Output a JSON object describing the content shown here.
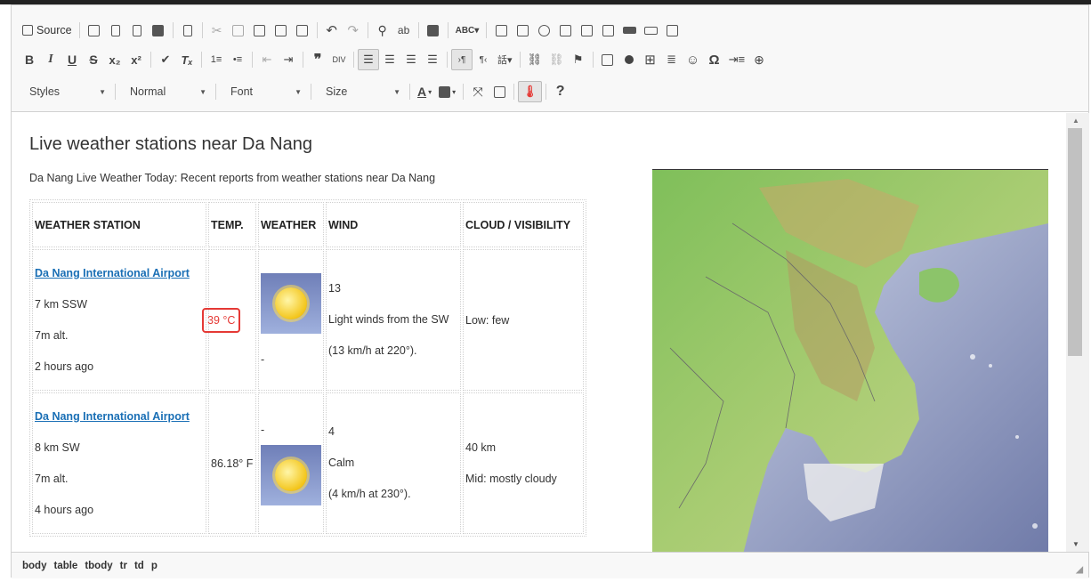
{
  "toolbar": {
    "source_label": "Source",
    "styles_combo": "Styles",
    "format_combo": "Normal",
    "font_combo": "Font",
    "size_combo": "Size",
    "help_label": "?"
  },
  "content": {
    "heading": "Live weather stations near Da Nang",
    "intro": "Da Nang Live Weather Today: Recent reports from weather stations near Da Nang",
    "headers": [
      "WEATHER STATION",
      "TEMP.",
      "WEATHER",
      "WIND",
      "CLOUD / VISIBILITY"
    ],
    "rows": [
      {
        "station": "Da Nang International Airport",
        "distance": "7 km SSW",
        "altitude": "7m alt.",
        "time": "2 hours ago",
        "temp": "39 °C",
        "weather_note": "-",
        "wind_speed": "13",
        "wind_desc": "Light winds from the SW",
        "wind_detail": "(13 km/h at 220°).",
        "cloud_1": "Low: few",
        "cloud_2": ""
      },
      {
        "station": "Da Nang International Airport",
        "distance": "8 km SW",
        "altitude": "7m alt.",
        "time": "4 hours ago",
        "temp": "86.18° F",
        "weather_note": "-",
        "wind_speed": "4",
        "wind_desc": "Calm",
        "wind_detail": "(4 km/h at 230°).",
        "cloud_1": "40 km",
        "cloud_2": "Mid: mostly cloudy"
      }
    ]
  },
  "statusbar": {
    "path": [
      "body",
      "table",
      "tbody",
      "tr",
      "td",
      "p"
    ]
  },
  "colors": {
    "link": "#1a6fb5",
    "temp_highlight": "#e53935"
  }
}
